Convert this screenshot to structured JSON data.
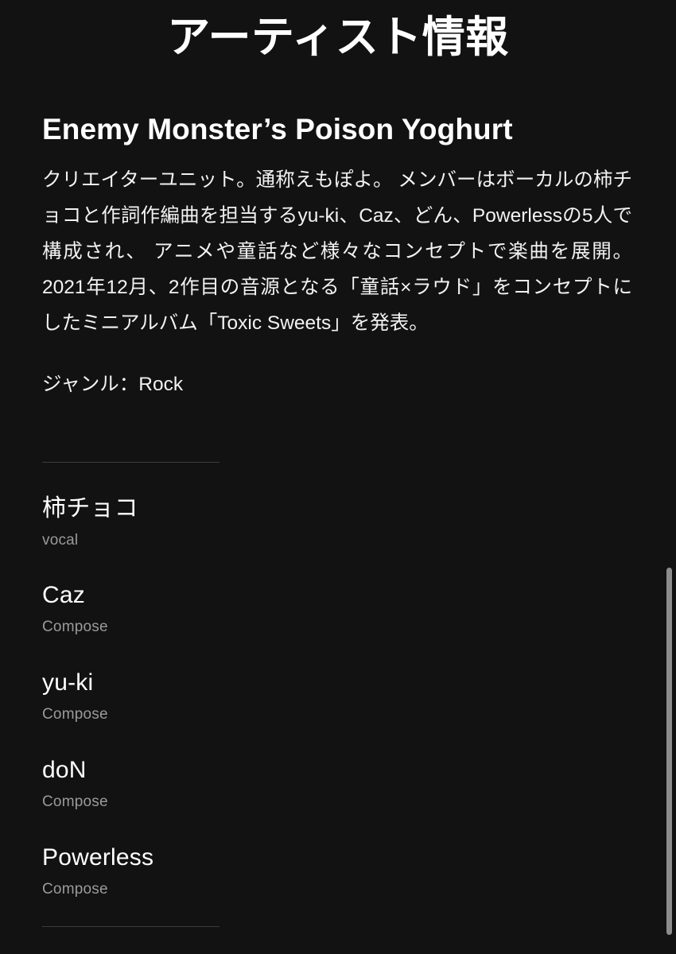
{
  "page": {
    "title": "アーティスト情報",
    "background_color": "#121212",
    "text_color": "#ffffff",
    "muted_text_color": "#9a9a9a",
    "divider_color": "#3b3b3b"
  },
  "artist": {
    "name": "Enemy Monster’s Poison Yoghurt",
    "bio": "クリエイターユニット。通称えもぽよ。 メンバーはボーカルの柿チョコと作詞作編曲を担当するyu-ki、Caz、どん、Powerlessの5人で構成され、 アニメや童話など様々なコンセプトで楽曲を展開。 2021年12月、2作目の音源となる「童話×ラウド」をコンセプトにしたミニアルバム「Toxic Sweets」を発表。",
    "genre": "ジャンル：Rock"
  },
  "members": [
    {
      "name": "柿チョコ",
      "role": "vocal"
    },
    {
      "name": "Caz",
      "role": "Compose"
    },
    {
      "name": "yu-ki",
      "role": "Compose"
    },
    {
      "name": "doN",
      "role": "Compose"
    },
    {
      "name": "Powerless",
      "role": "Compose"
    }
  ],
  "scrollbar": {
    "thumb_color": "#8c8c8c",
    "position": "right"
  }
}
